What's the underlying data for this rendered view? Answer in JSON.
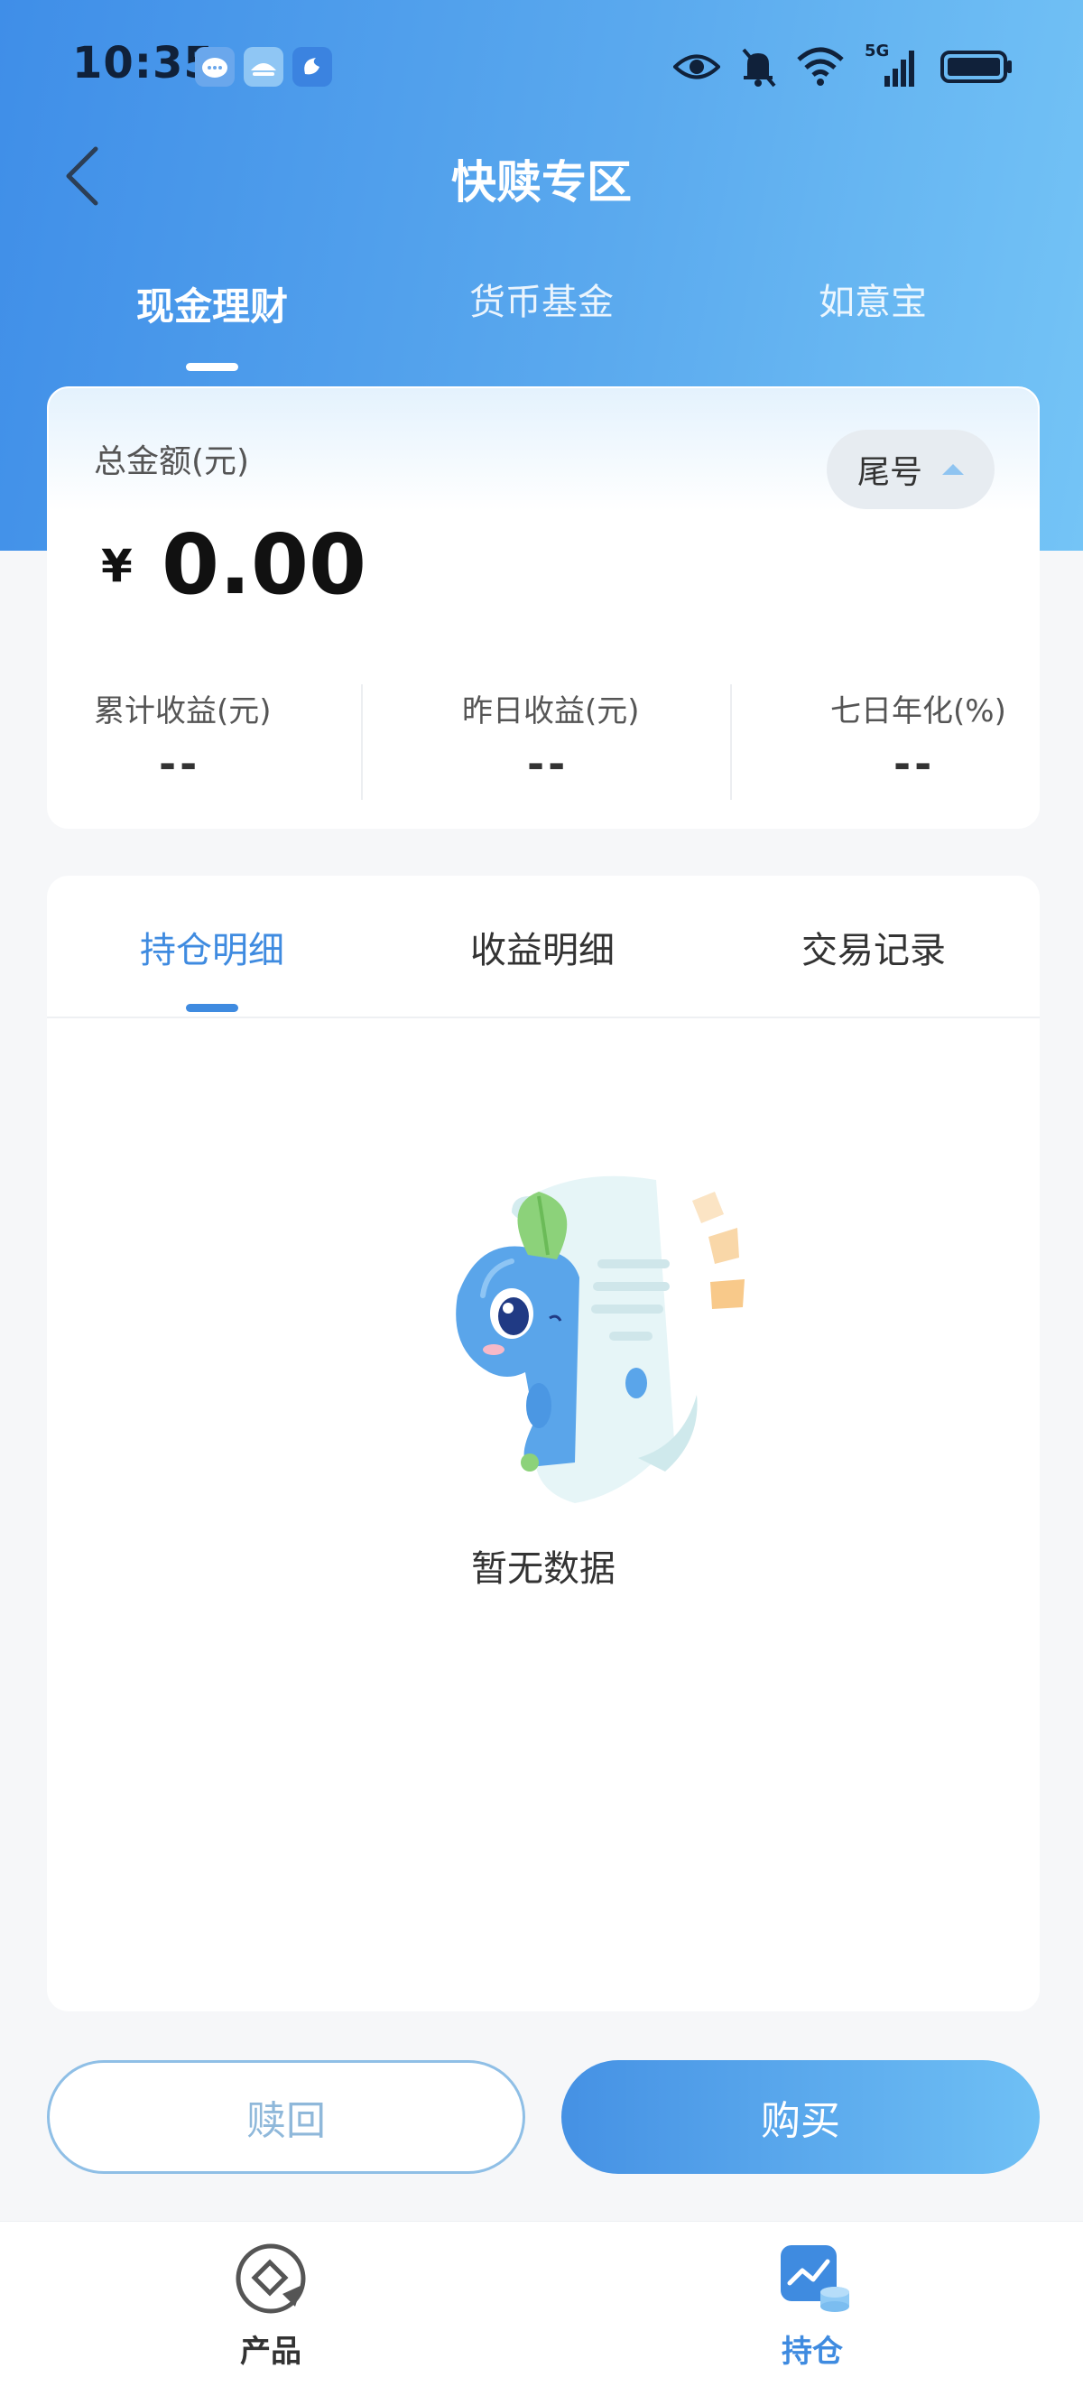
{
  "status_bar": {
    "time": "10:35",
    "network": "5G",
    "icons": [
      "message-app-icon",
      "weather-app-icon",
      "browser-app-icon",
      "eye-icon",
      "bell-muted-icon",
      "wifi-icon",
      "signal-icon",
      "battery-icon"
    ]
  },
  "header": {
    "title": "快赎专区",
    "tabs": [
      {
        "label": "现金理财",
        "active": true
      },
      {
        "label": "货币基金",
        "active": false
      },
      {
        "label": "如意宝",
        "active": false
      }
    ]
  },
  "summary": {
    "total_label": "总金额(元)",
    "tail_label": "尾号",
    "currency": "¥",
    "amount": "0.00",
    "metrics": [
      {
        "label": "累计收益(元)",
        "value": "--"
      },
      {
        "label": "昨日收益(元)",
        "value": "--"
      },
      {
        "label": "七日年化(%)",
        "value": "--"
      }
    ]
  },
  "details": {
    "tabs": [
      {
        "label": "持仓明细",
        "active": true
      },
      {
        "label": "收益明细",
        "active": false
      },
      {
        "label": "交易记录",
        "active": false
      }
    ],
    "empty_text": "暂无数据"
  },
  "actions": {
    "redeem_label": "赎回",
    "buy_label": "购买"
  },
  "bottom_nav": {
    "items": [
      {
        "label": "产品",
        "active": false,
        "icon": "product-icon"
      },
      {
        "label": "持仓",
        "active": true,
        "icon": "holdings-icon"
      }
    ]
  },
  "colors": {
    "accent": "#3f8be0",
    "header_start": "#3f8ee8",
    "header_end": "#74c4f6"
  }
}
